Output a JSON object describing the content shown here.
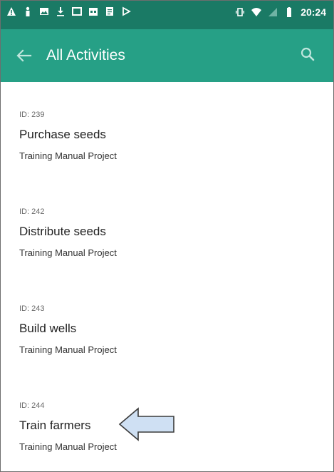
{
  "status_bar": {
    "time": "20:24",
    "left_icons": [
      "warning-icon",
      "person-icon",
      "image-icon",
      "download-icon",
      "window-icon",
      "calendar-icon",
      "document-icon",
      "play-icon"
    ],
    "right_icons": [
      "vibrate-icon",
      "wifi-icon",
      "signal-icon",
      "battery-icon"
    ]
  },
  "app_bar": {
    "title": "All Activities",
    "back_icon": "back-arrow-icon",
    "search_icon": "search-icon",
    "background": "#26a086",
    "status_background": "#1a7a65"
  },
  "activities": [
    {
      "id_label": "ID: 239",
      "name": "Purchase seeds",
      "project": "Training Manual Project"
    },
    {
      "id_label": "ID: 242",
      "name": "Distribute seeds",
      "project": "Training Manual Project"
    },
    {
      "id_label": "ID: 243",
      "name": "Build wells",
      "project": "Training Manual Project"
    },
    {
      "id_label": "ID: 244",
      "name": "Train farmers",
      "project": "Training Manual Project"
    }
  ],
  "annotation": {
    "icon": "pointer-arrow-icon",
    "fill": "#cfe0f3",
    "stroke": "#3a3a3a"
  }
}
